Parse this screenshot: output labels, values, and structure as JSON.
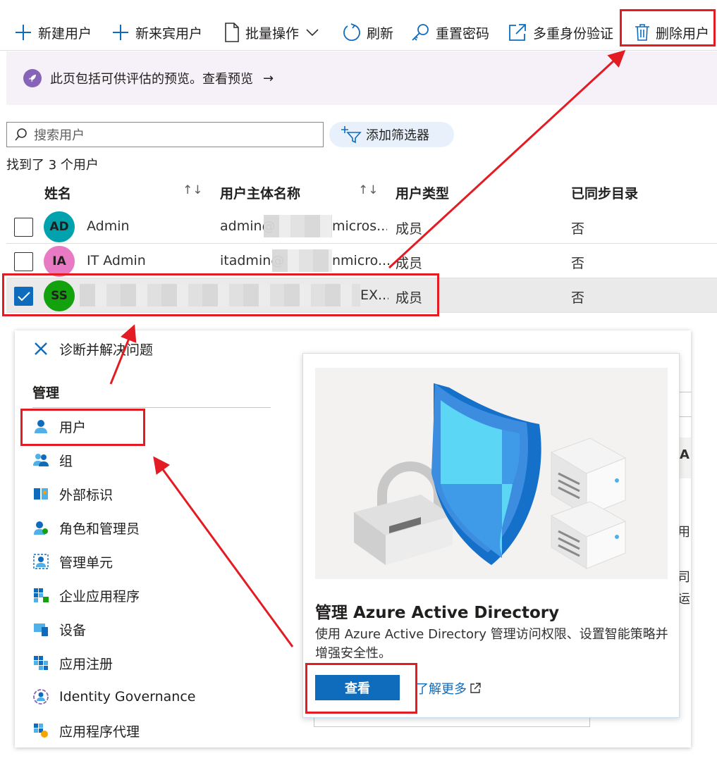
{
  "toolbar": {
    "new_user": "新建用户",
    "new_guest": "新来宾用户",
    "bulk_ops": "批量操作",
    "refresh": "刷新",
    "reset_password": "重置密码",
    "mfa": "多重身份验证",
    "delete_user": "删除用户"
  },
  "banner": {
    "text": "此页包括可供评估的预览。查看预览",
    "arrow": "→"
  },
  "search": {
    "placeholder": "搜索用户"
  },
  "filter": {
    "label": "添加筛选器"
  },
  "results": {
    "found": "找到了 3 个用户"
  },
  "table": {
    "headers": {
      "name": "姓名",
      "upn": "用户主体名称",
      "type": "用户类型",
      "synced": "已同步目录"
    },
    "sort_glyph": "↑↓",
    "rows": [
      {
        "initials": "AD",
        "name": "Admin",
        "upn_start": "admin@",
        "upn_end": "micros...",
        "type": "成员",
        "synced": "否",
        "avatar_color": "#00a2ad",
        "checked": false
      },
      {
        "initials": "IA",
        "name": "IT Admin",
        "upn_start": "itadmin@",
        "upn_end": "nmicro...",
        "type": "成员",
        "synced": "否",
        "avatar_color": "#e87ac4",
        "checked": false
      },
      {
        "initials": "SS",
        "name": "",
        "upn_start": "",
        "upn_end": "EX...",
        "type": "成员",
        "synced": "否",
        "avatar_color": "#13a10e",
        "checked": true
      }
    ]
  },
  "nav": {
    "diagnose": "诊断并解决问题",
    "heading": "管理",
    "items": [
      {
        "label": "用户",
        "icon": "user-icon"
      },
      {
        "label": "组",
        "icon": "group-icon"
      },
      {
        "label": "外部标识",
        "icon": "external-identity-icon"
      },
      {
        "label": "角色和管理员",
        "icon": "roles-icon"
      },
      {
        "label": "管理单元",
        "icon": "admin-unit-icon"
      },
      {
        "label": "企业应用程序",
        "icon": "enterprise-apps-icon"
      },
      {
        "label": "设备",
        "icon": "device-icon"
      },
      {
        "label": "应用注册",
        "icon": "app-registration-icon"
      },
      {
        "label": "Identity Governance",
        "icon": "identity-governance-icon"
      },
      {
        "label": "应用程序代理",
        "icon": "app-proxy-icon"
      }
    ]
  },
  "background_fragments": {
    "a": "A",
    "b": "用",
    "c": "司",
    "d": "运"
  },
  "card": {
    "title": "管理 Azure Active Directory",
    "description": "使用 Azure Active Directory 管理访问权限、设置智能策略并增强安全性。",
    "view_button": "查看",
    "learn_more": "了解更多"
  },
  "colors": {
    "accent": "#0f6cbd",
    "annotation": "#e31b23",
    "banner_bg": "#f6f0f8"
  }
}
